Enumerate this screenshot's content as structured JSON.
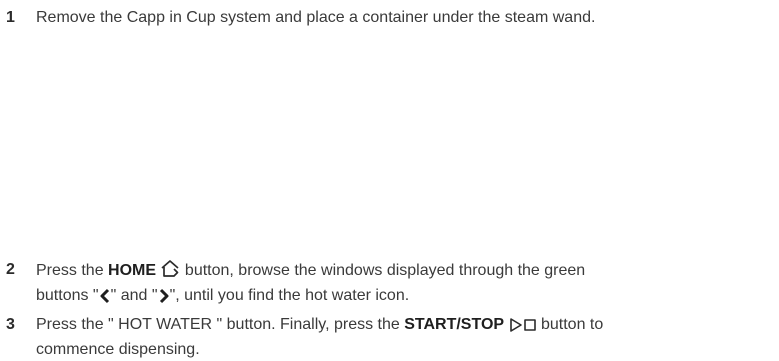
{
  "steps": [
    {
      "number": "1",
      "text": "Remove the Capp in Cup system and place a container under the steam wand."
    },
    {
      "number": "2",
      "t1": "Press the ",
      "bold": "HOME",
      "home_icon": "home-icon",
      "t2": " button, browse the windows displayed through the green",
      "t3": "buttons \"",
      "left_icon": "chevron-left-icon",
      "t4": "\" and \"",
      "right_icon": "chevron-right-icon",
      "t5": "\", until you find the hot water icon."
    },
    {
      "number": "3",
      "t1": "Press the \" HOT WATER \" button. Finally, press the ",
      "bold": "START/STOP",
      "icon": "start-stop-icon",
      "t2": " button to",
      "t3": "commence dispensing."
    }
  ]
}
